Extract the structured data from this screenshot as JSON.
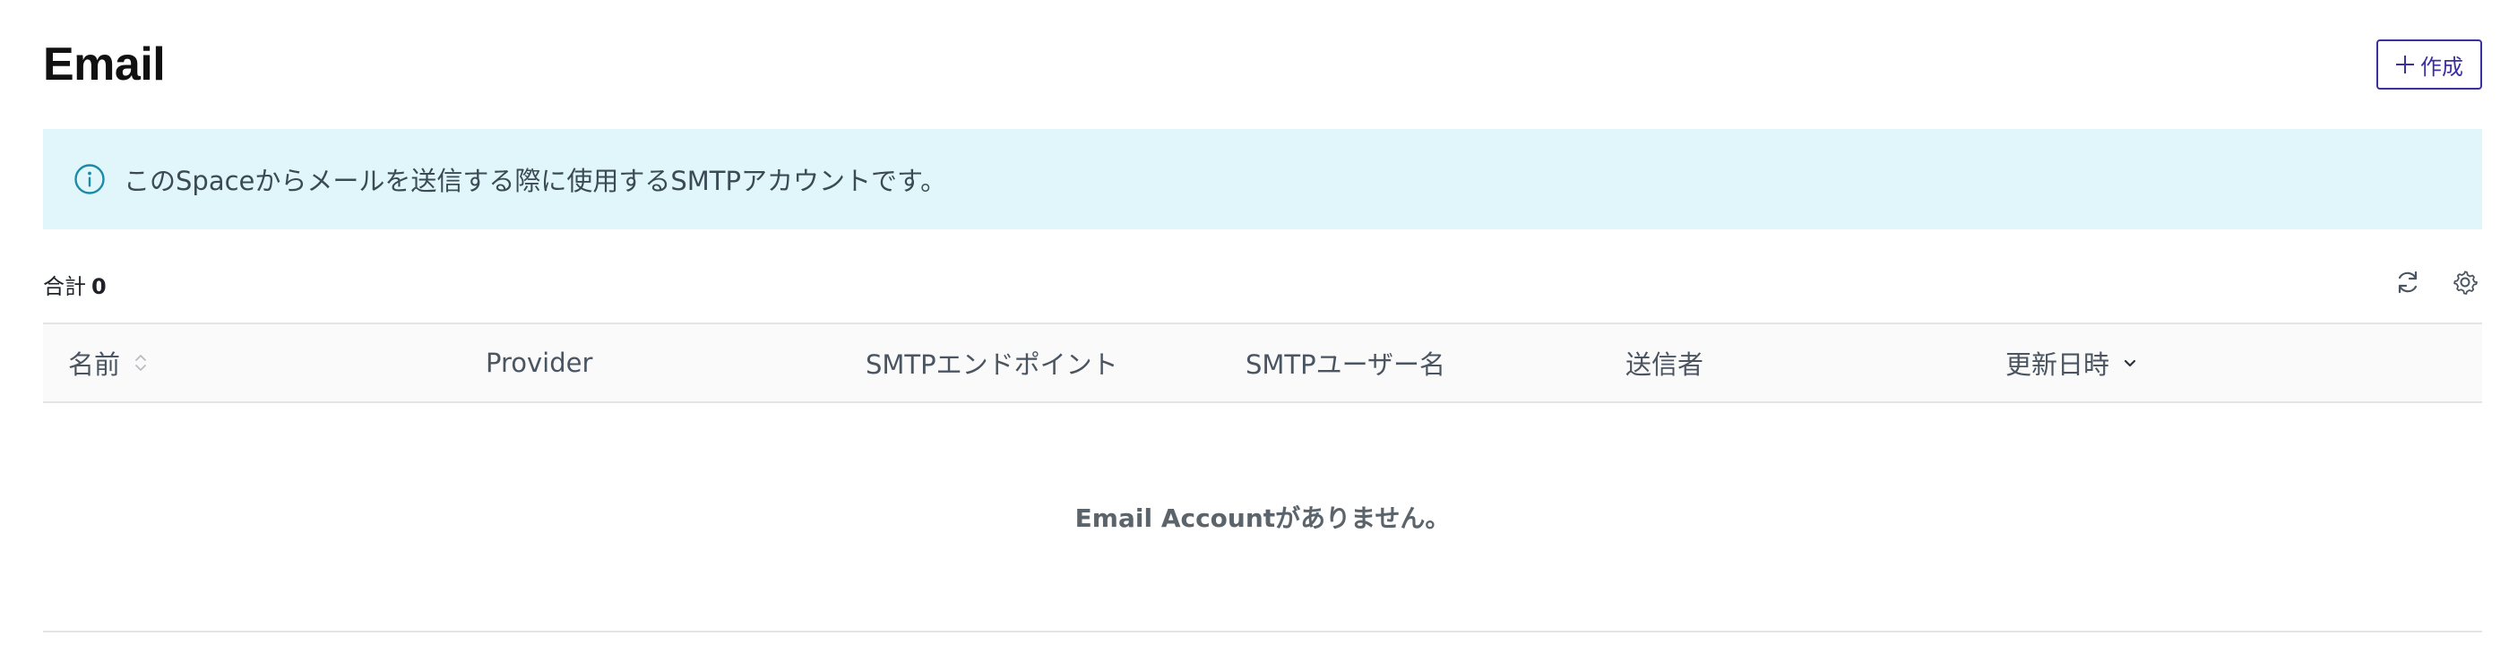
{
  "header": {
    "title": "Email",
    "create_label": "作成"
  },
  "banner": {
    "text": "このSpaceからメールを送信する際に使用するSMTPアカウントです。",
    "icon": "info-circle-icon",
    "background": "#e0f6fb",
    "icon_color": "#1b8aa6"
  },
  "summary": {
    "label": "合計",
    "count": "0"
  },
  "toolbar": {
    "icons": [
      "refresh-icon",
      "settings-gear-icon"
    ]
  },
  "table": {
    "columns": [
      "名前",
      "Provider",
      "SMTPエンドポイント",
      "SMTPユーザー名",
      "送信者",
      "更新日時"
    ],
    "sortable": {
      "name": "unsorted",
      "updated": "descending"
    },
    "empty_message": "Email Accountがありません。"
  },
  "colors": {
    "accent": "#3b2fa3",
    "border": "#e4e4e4",
    "header_bg": "#fafafa"
  }
}
